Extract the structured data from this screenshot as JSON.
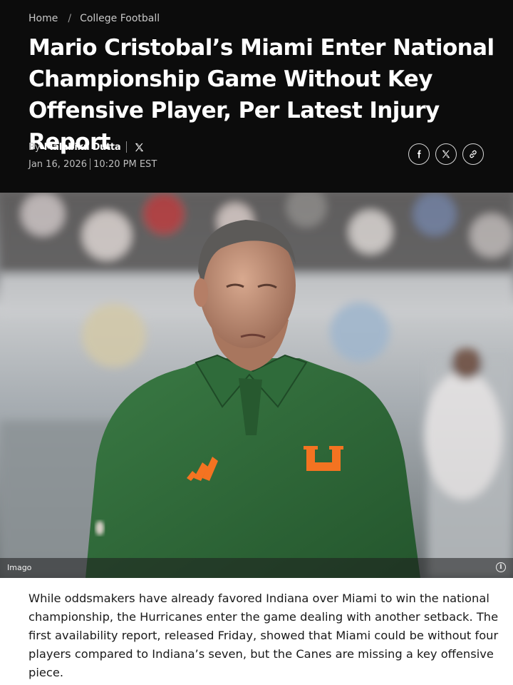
{
  "breadcrumb": {
    "home": "Home",
    "separator": "/",
    "section": "College Football"
  },
  "article": {
    "title": "Mario Cristobal’s Miami Enter National Championship Game Without Key Offensive Player, Per Latest Injury Report",
    "byline_prefix": "By",
    "author": "Malabika Dutta",
    "date": "Jan 16, 2026",
    "time": "10:20 PM EST",
    "image_caption": "Imago",
    "body": "While oddsmakers have already favored Indiana over Miami to win the national championship, the Hurricanes enter the game dealing with another setback. The first availability report, released Friday, showed that Miami could be without four players compared to Indiana’s seven, but the Canes are missing a key offensive piece."
  },
  "share": {
    "icons": [
      "facebook-icon",
      "x-icon",
      "link-icon"
    ]
  },
  "colors": {
    "header_bg": "#0c0c0c",
    "shirt_green": "#2f6b3a",
    "logo_orange": "#f47321",
    "text": "#1a1a1a"
  }
}
